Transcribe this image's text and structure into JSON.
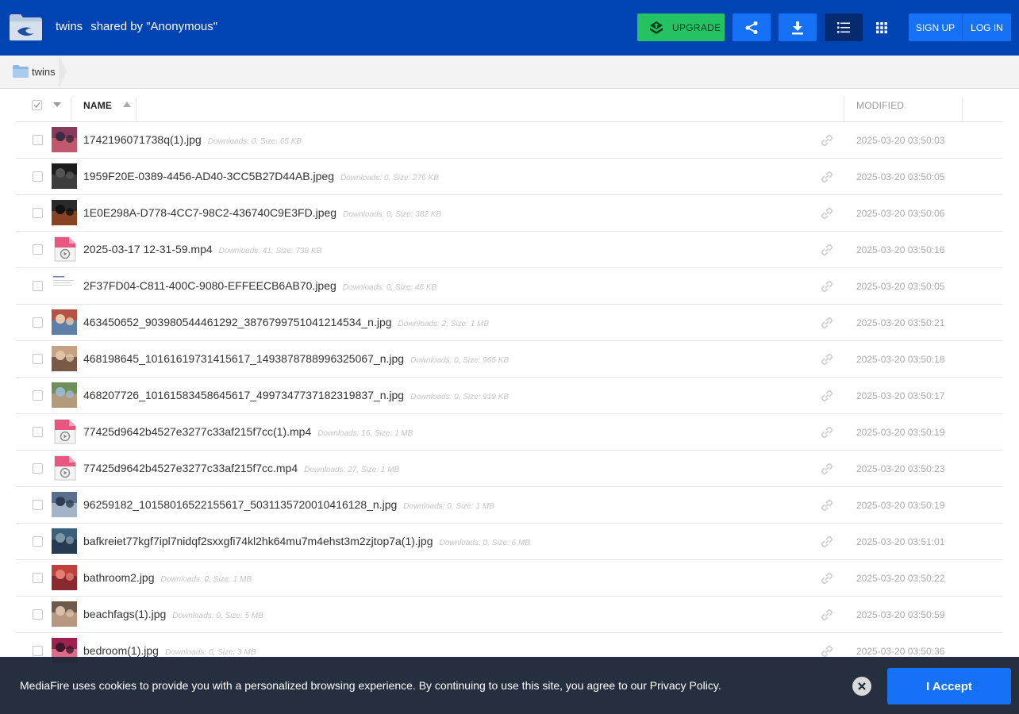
{
  "header": {
    "folder_name": "twins",
    "shared_by": "shared by \"Anonymous\"",
    "upgrade_label": "UPGRADE",
    "signup_label": "SIGN UP",
    "login_label": "LOG IN",
    "colors": {
      "bar": "#0044b3",
      "upgrade": "#24c263",
      "button": "#1571f5",
      "active": "#042b6f"
    }
  },
  "breadcrumb": {
    "label": "twins"
  },
  "table": {
    "col_name": "NAME",
    "col_modified": "MODIFIED",
    "files": [
      {
        "name": "1742196071738q(1).jpg",
        "meta": "Downloads: 0, Size: 65 KB",
        "modified": "2025-03-20 03:50:03",
        "icon": "photo-thumb"
      },
      {
        "name": "1959F20E-0389-4456-AD40-3CC5B27D44AB.jpeg",
        "meta": "Downloads: 0, Size: 276 KB",
        "modified": "2025-03-20 03:50:05",
        "icon": "photo-thumb"
      },
      {
        "name": "1E0E298A-D778-4CC7-98C2-436740C9E3FD.jpeg",
        "meta": "Downloads: 0, Size: 382 KB",
        "modified": "2025-03-20 03:50:06",
        "icon": "photo-thumb"
      },
      {
        "name": "2025-03-17 12-31-59.mp4",
        "meta": "Downloads: 41, Size: 738 KB",
        "modified": "2025-03-20 03:50:16",
        "icon": "video-file-icon"
      },
      {
        "name": "2F37FD04-C811-400C-9080-EFFEECB6AB70.jpeg",
        "meta": "Downloads: 0, Size: 46 KB",
        "modified": "2025-03-20 03:50:05",
        "icon": "document-thumb"
      },
      {
        "name": "463450652_903980544461292_3876799751041214534_n.jpg",
        "meta": "Downloads: 2, Size: 1 MB",
        "modified": "2025-03-20 03:50:21",
        "icon": "photo-thumb"
      },
      {
        "name": "468198645_10161619731415617_1493878788996325067_n.jpg",
        "meta": "Downloads: 0, Size: 965 KB",
        "modified": "2025-03-20 03:50:18",
        "icon": "photo-thumb"
      },
      {
        "name": "468207726_10161583458645617_4997347737182319837_n.jpg",
        "meta": "Downloads: 0, Size: 919 KB",
        "modified": "2025-03-20 03:50:17",
        "icon": "photo-thumb"
      },
      {
        "name": "77425d9642b4527e3277c33af215f7cc(1).mp4",
        "meta": "Downloads: 16, Size: 1 MB",
        "modified": "2025-03-20 03:50:19",
        "icon": "video-file-icon"
      },
      {
        "name": "77425d9642b4527e3277c33af215f7cc.mp4",
        "meta": "Downloads: 27, Size: 1 MB",
        "modified": "2025-03-20 03:50:23",
        "icon": "video-file-icon"
      },
      {
        "name": "96259182_10158016522155617_5031135720010416128_n.jpg",
        "meta": "Downloads: 0, Size: 1 MB",
        "modified": "2025-03-20 03:50:19",
        "icon": "photo-thumb"
      },
      {
        "name": "bafkreiet77kgf7ipl7nidqf2sxxgfi74kl2hk64mu7m4ehst3m2zjtop7a(1).jpg",
        "meta": "Downloads: 0, Size: 6 MB",
        "modified": "2025-03-20 03:51:01",
        "icon": "photo-thumb"
      },
      {
        "name": "bathroom2.jpg",
        "meta": "Downloads: 0, Size: 1 MB",
        "modified": "2025-03-20 03:50:22",
        "icon": "photo-thumb"
      },
      {
        "name": "beachfags(1).jpg",
        "meta": "Downloads: 0, Size: 5 MB",
        "modified": "2025-03-20 03:50:59",
        "icon": "photo-thumb"
      },
      {
        "name": "bedroom(1).jpg",
        "meta": "Downloads: 0, Size: 3 MB",
        "modified": "2025-03-20 03:50:36",
        "icon": "photo-thumb"
      }
    ]
  },
  "cookie": {
    "text": "MediaFire uses cookies to provide you with a personalized browsing experience. By continuing to use this site, you agree to our Privacy Policy.",
    "accept_label": "I Accept"
  }
}
